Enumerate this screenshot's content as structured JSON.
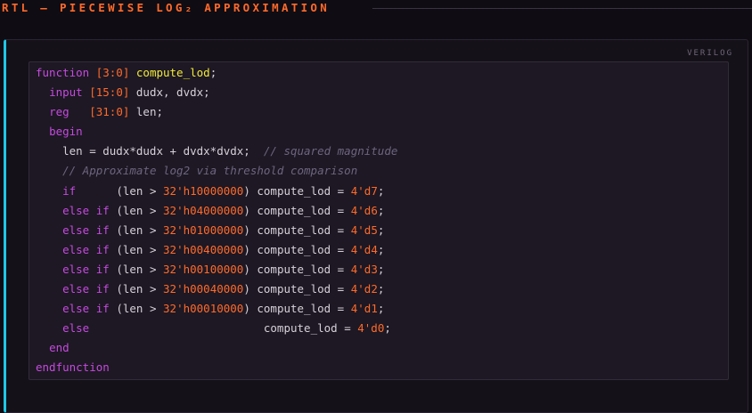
{
  "header": {
    "title": "RTL — PIECEWISE LOG₂ APPROXIMATION"
  },
  "code_panel": {
    "language_label": "VERILOG",
    "lines": [
      [
        {
          "t": "kw",
          "s": "function "
        },
        {
          "t": "num",
          "s": "[3:0]"
        },
        {
          "t": "pl",
          "s": " "
        },
        {
          "t": "fn",
          "s": "compute_lod"
        },
        {
          "t": "pl",
          "s": ";"
        }
      ],
      [
        {
          "t": "pl",
          "s": "  "
        },
        {
          "t": "kw",
          "s": "input "
        },
        {
          "t": "num",
          "s": "[15:0]"
        },
        {
          "t": "pl",
          "s": " dudx, dvdx;"
        }
      ],
      [
        {
          "t": "pl",
          "s": "  "
        },
        {
          "t": "kw",
          "s": "reg   "
        },
        {
          "t": "num",
          "s": "[31:0]"
        },
        {
          "t": "pl",
          "s": " len;"
        }
      ],
      [
        {
          "t": "pl",
          "s": "  "
        },
        {
          "t": "kw",
          "s": "begin"
        }
      ],
      [
        {
          "t": "pl",
          "s": "    len = dudx*dudx + dvdx*dvdx;  "
        },
        {
          "t": "cm",
          "s": "// squared magnitude"
        }
      ],
      [
        {
          "t": "pl",
          "s": "    "
        },
        {
          "t": "cm",
          "s": "// Approximate log2 via threshold comparison"
        }
      ],
      [
        {
          "t": "pl",
          "s": "    "
        },
        {
          "t": "kw",
          "s": "if"
        },
        {
          "t": "pl",
          "s": "      (len > "
        },
        {
          "t": "num",
          "s": "32'h10000000"
        },
        {
          "t": "pl",
          "s": ") compute_lod = "
        },
        {
          "t": "num",
          "s": "4'd7"
        },
        {
          "t": "pl",
          "s": ";"
        }
      ],
      [
        {
          "t": "pl",
          "s": "    "
        },
        {
          "t": "kw",
          "s": "else if"
        },
        {
          "t": "pl",
          "s": " (len > "
        },
        {
          "t": "num",
          "s": "32'h04000000"
        },
        {
          "t": "pl",
          "s": ") compute_lod = "
        },
        {
          "t": "num",
          "s": "4'd6"
        },
        {
          "t": "pl",
          "s": ";"
        }
      ],
      [
        {
          "t": "pl",
          "s": "    "
        },
        {
          "t": "kw",
          "s": "else if"
        },
        {
          "t": "pl",
          "s": " (len > "
        },
        {
          "t": "num",
          "s": "32'h01000000"
        },
        {
          "t": "pl",
          "s": ") compute_lod = "
        },
        {
          "t": "num",
          "s": "4'd5"
        },
        {
          "t": "pl",
          "s": ";"
        }
      ],
      [
        {
          "t": "pl",
          "s": "    "
        },
        {
          "t": "kw",
          "s": "else if"
        },
        {
          "t": "pl",
          "s": " (len > "
        },
        {
          "t": "num",
          "s": "32'h00400000"
        },
        {
          "t": "pl",
          "s": ") compute_lod = "
        },
        {
          "t": "num",
          "s": "4'd4"
        },
        {
          "t": "pl",
          "s": ";"
        }
      ],
      [
        {
          "t": "pl",
          "s": "    "
        },
        {
          "t": "kw",
          "s": "else if"
        },
        {
          "t": "pl",
          "s": " (len > "
        },
        {
          "t": "num",
          "s": "32'h00100000"
        },
        {
          "t": "pl",
          "s": ") compute_lod = "
        },
        {
          "t": "num",
          "s": "4'd3"
        },
        {
          "t": "pl",
          "s": ";"
        }
      ],
      [
        {
          "t": "pl",
          "s": "    "
        },
        {
          "t": "kw",
          "s": "else if"
        },
        {
          "t": "pl",
          "s": " (len > "
        },
        {
          "t": "num",
          "s": "32'h00040000"
        },
        {
          "t": "pl",
          "s": ") compute_lod = "
        },
        {
          "t": "num",
          "s": "4'd2"
        },
        {
          "t": "pl",
          "s": ";"
        }
      ],
      [
        {
          "t": "pl",
          "s": "    "
        },
        {
          "t": "kw",
          "s": "else if"
        },
        {
          "t": "pl",
          "s": " (len > "
        },
        {
          "t": "num",
          "s": "32'h00010000"
        },
        {
          "t": "pl",
          "s": ") compute_lod = "
        },
        {
          "t": "num",
          "s": "4'd1"
        },
        {
          "t": "pl",
          "s": ";"
        }
      ],
      [
        {
          "t": "pl",
          "s": "    "
        },
        {
          "t": "kw",
          "s": "else"
        },
        {
          "t": "pl",
          "s": "                          compute_lod = "
        },
        {
          "t": "num",
          "s": "4'd0"
        },
        {
          "t": "pl",
          "s": ";"
        }
      ],
      [
        {
          "t": "pl",
          "s": "  "
        },
        {
          "t": "kw",
          "s": "end"
        }
      ],
      [
        {
          "t": "kw",
          "s": "endfunction"
        }
      ]
    ]
  },
  "colors": {
    "accent_orange": "#ff6a2b",
    "keyword_purple": "#c64ae0",
    "function_yellow": "#f2e93a",
    "comment_gray": "#6d6580",
    "panel_accent_cyan": "#1ec8e6"
  }
}
